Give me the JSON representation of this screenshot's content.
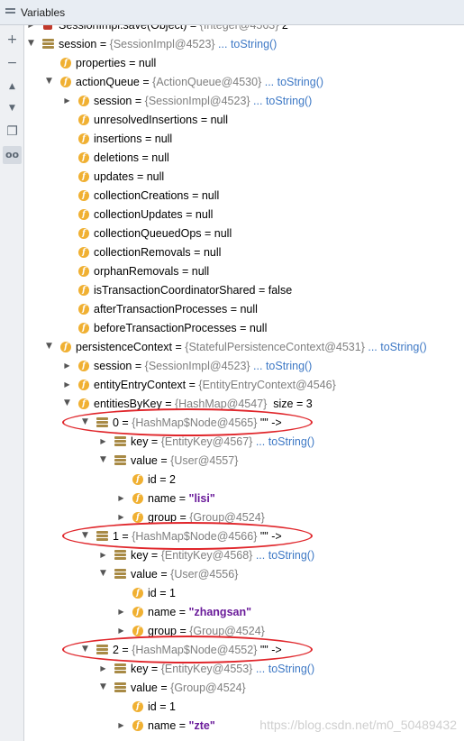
{
  "panel": {
    "title": "Variables"
  },
  "toolbar": {
    "add": "+",
    "minus": "−",
    "up": "▲",
    "down": "▼",
    "copy": "❐",
    "glasses": "oo"
  },
  "rows": [
    {
      "indent": 0,
      "arrow": "expand",
      "icon": "static",
      "name": "SessionImpl.save(Object)",
      "eq": " = ",
      "ref": "{Integer@4563}",
      "value": " 2"
    },
    {
      "indent": 0,
      "arrow": "collapse",
      "icon": "entry",
      "name": "session",
      "eq": " = ",
      "ref": "{SessionImpl@4523}",
      "link": " ... toString()"
    },
    {
      "indent": 1,
      "arrow": "",
      "icon": "field",
      "name": "properties",
      "eq": " = ",
      "value": "null"
    },
    {
      "indent": 1,
      "arrow": "collapse",
      "icon": "field",
      "name": "actionQueue",
      "eq": " = ",
      "ref": "{ActionQueue@4530}",
      "link": " ... toString()"
    },
    {
      "indent": 2,
      "arrow": "expand",
      "icon": "field",
      "name": "session",
      "eq": " = ",
      "ref": "{SessionImpl@4523}",
      "link": " ... toString()"
    },
    {
      "indent": 2,
      "arrow": "",
      "icon": "field",
      "name": "unresolvedInsertions",
      "eq": " = ",
      "value": "null"
    },
    {
      "indent": 2,
      "arrow": "",
      "icon": "field",
      "name": "insertions",
      "eq": " = ",
      "value": "null"
    },
    {
      "indent": 2,
      "arrow": "",
      "icon": "field",
      "name": "deletions",
      "eq": " = ",
      "value": "null"
    },
    {
      "indent": 2,
      "arrow": "",
      "icon": "field",
      "name": "updates",
      "eq": " = ",
      "value": "null"
    },
    {
      "indent": 2,
      "arrow": "",
      "icon": "field",
      "name": "collectionCreations",
      "eq": " = ",
      "value": "null"
    },
    {
      "indent": 2,
      "arrow": "",
      "icon": "field",
      "name": "collectionUpdates",
      "eq": " = ",
      "value": "null"
    },
    {
      "indent": 2,
      "arrow": "",
      "icon": "field",
      "name": "collectionQueuedOps",
      "eq": " = ",
      "value": "null"
    },
    {
      "indent": 2,
      "arrow": "",
      "icon": "field",
      "name": "collectionRemovals",
      "eq": " = ",
      "value": "null"
    },
    {
      "indent": 2,
      "arrow": "",
      "icon": "field",
      "name": "orphanRemovals",
      "eq": " = ",
      "value": "null"
    },
    {
      "indent": 2,
      "arrow": "",
      "icon": "field",
      "name": "isTransactionCoordinatorShared",
      "eq": " = ",
      "value": "false"
    },
    {
      "indent": 2,
      "arrow": "",
      "icon": "field",
      "name": "afterTransactionProcesses",
      "eq": " = ",
      "value": "null"
    },
    {
      "indent": 2,
      "arrow": "",
      "icon": "field",
      "name": "beforeTransactionProcesses",
      "eq": " = ",
      "value": "null"
    },
    {
      "indent": 1,
      "arrow": "collapse",
      "icon": "field",
      "name": "persistenceContext",
      "eq": " = ",
      "ref": "{StatefulPersistenceContext@4531}",
      "link": " ... toString()"
    },
    {
      "indent": 2,
      "arrow": "expand",
      "icon": "field",
      "name": "session",
      "eq": " = ",
      "ref": "{SessionImpl@4523}",
      "link": " ... toString()"
    },
    {
      "indent": 2,
      "arrow": "expand",
      "icon": "field",
      "name": "entityEntryContext",
      "eq": " = ",
      "ref": "{EntityEntryContext@4546}"
    },
    {
      "indent": 2,
      "arrow": "collapse",
      "icon": "field",
      "name": "entitiesByKey",
      "eq": " = ",
      "ref": "{HashMap@4547}",
      "value": "  size = 3"
    },
    {
      "indent": 3,
      "arrow": "collapse",
      "icon": "entry",
      "name": "0",
      "eq": " = ",
      "ref": "{HashMap$Node@4565}",
      "value": " \"\" ->"
    },
    {
      "indent": 4,
      "arrow": "expand",
      "icon": "entry",
      "name": "key",
      "eq": " = ",
      "ref": "{EntityKey@4567}",
      "link": " ... toString()"
    },
    {
      "indent": 4,
      "arrow": "collapse",
      "icon": "entry",
      "name": "value",
      "eq": " = ",
      "ref": "{User@4557}"
    },
    {
      "indent": 5,
      "arrow": "",
      "icon": "field",
      "name": "id",
      "eq": " = ",
      "value": "2"
    },
    {
      "indent": 5,
      "arrow": "expand",
      "icon": "field",
      "name": "name",
      "eq": " = ",
      "str": "\"lisi\""
    },
    {
      "indent": 5,
      "arrow": "expand",
      "icon": "field",
      "name": "group",
      "eq": " = ",
      "ref": "{Group@4524}"
    },
    {
      "indent": 3,
      "arrow": "collapse",
      "icon": "entry",
      "name": "1",
      "eq": " = ",
      "ref": "{HashMap$Node@4566}",
      "value": " \"\" ->"
    },
    {
      "indent": 4,
      "arrow": "expand",
      "icon": "entry",
      "name": "key",
      "eq": " = ",
      "ref": "{EntityKey@4568}",
      "link": " ... toString()"
    },
    {
      "indent": 4,
      "arrow": "collapse",
      "icon": "entry",
      "name": "value",
      "eq": " = ",
      "ref": "{User@4556}"
    },
    {
      "indent": 5,
      "arrow": "",
      "icon": "field",
      "name": "id",
      "eq": " = ",
      "value": "1"
    },
    {
      "indent": 5,
      "arrow": "expand",
      "icon": "field",
      "name": "name",
      "eq": " = ",
      "str": "\"zhangsan\""
    },
    {
      "indent": 5,
      "arrow": "expand",
      "icon": "field",
      "name": "group",
      "eq": " = ",
      "ref": "{Group@4524}"
    },
    {
      "indent": 3,
      "arrow": "collapse",
      "icon": "entry",
      "name": "2",
      "eq": " = ",
      "ref": "{HashMap$Node@4552}",
      "value": " \"\" ->"
    },
    {
      "indent": 4,
      "arrow": "expand",
      "icon": "entry",
      "name": "key",
      "eq": " = ",
      "ref": "{EntityKey@4553}",
      "link": " ... toString()"
    },
    {
      "indent": 4,
      "arrow": "collapse",
      "icon": "entry",
      "name": "value",
      "eq": " = ",
      "ref": "{Group@4524}"
    },
    {
      "indent": 5,
      "arrow": "",
      "icon": "field",
      "name": "id",
      "eq": " = ",
      "value": "1"
    },
    {
      "indent": 5,
      "arrow": "expand",
      "icon": "field",
      "name": "name",
      "eq": " = ",
      "str": "\"zte\""
    }
  ],
  "highlight_rows": [
    21,
    27,
    33
  ],
  "colors": {
    "highlight": "#e0262b",
    "field_icon": "#f0b032",
    "link": "#3d78c5"
  },
  "watermark": "https://blog.csdn.net/m0_50489432"
}
